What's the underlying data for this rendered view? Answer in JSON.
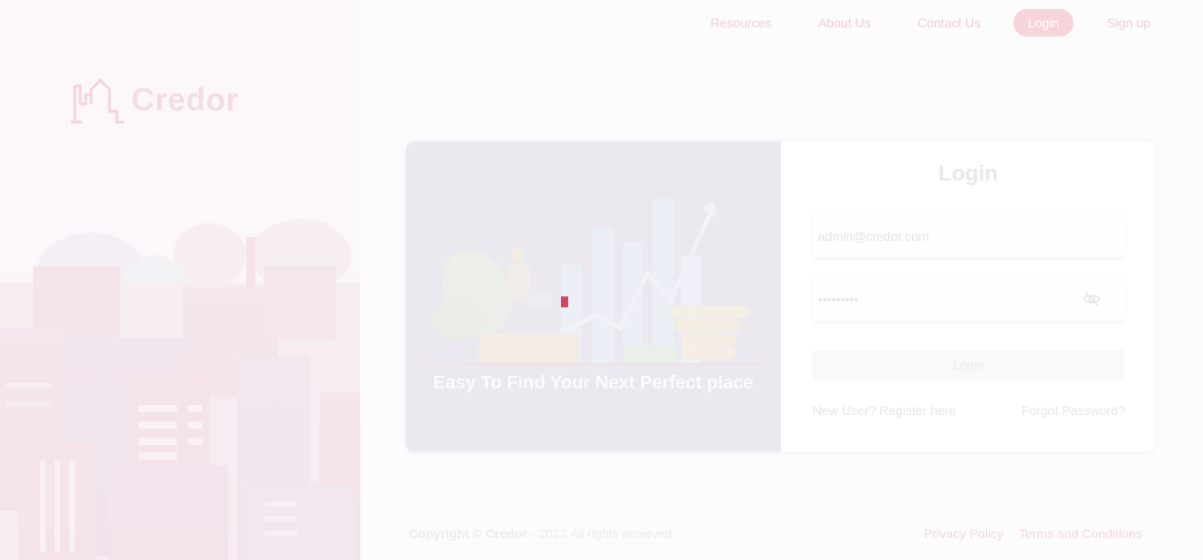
{
  "brand": {
    "name": "Credor"
  },
  "nav": {
    "resources": "Resources",
    "about": "About Us",
    "contact": "Contact Us",
    "login": "Login",
    "signup": "Sign up"
  },
  "hero": {
    "tagline": "Easy To Find Your Next Perfect place"
  },
  "form": {
    "title": "Login",
    "email_value": "admin@credor.com",
    "password_value": "•••••••••",
    "submit_label": "Login",
    "register_link": "New User? Register here",
    "forgot_link": "Forgot Password?"
  },
  "footer": {
    "copyright_prefix": "Copyright ©",
    "copyright_brand": "Credor",
    "copyright_suffix": "- 2022 All rights reserved",
    "privacy": "Privacy Policy",
    "terms": "Terms and Conditions"
  },
  "icons": {
    "logo": "city-outline-icon",
    "password_toggle": "eye-off-icon"
  },
  "colors": {
    "accent": "#c8102e",
    "nav_text": "#f4ccd4",
    "login_pill": "#f7d3da",
    "card_left_bg": "#ebe9ef"
  }
}
